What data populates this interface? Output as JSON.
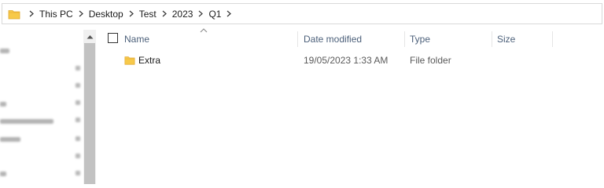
{
  "address_bar": {
    "breadcrumbs": [
      {
        "label": "This PC"
      },
      {
        "label": "Desktop"
      },
      {
        "label": "Test"
      },
      {
        "label": "2023"
      },
      {
        "label": "Q1"
      }
    ]
  },
  "columns": {
    "name": "Name",
    "date_modified": "Date modified",
    "type": "Type",
    "size": "Size"
  },
  "files": [
    {
      "name": "Extra",
      "date_modified": "19/05/2023 1:33 AM",
      "type": "File folder",
      "size": ""
    }
  ],
  "colors": {
    "folder": "#f7c94a",
    "header_text": "#4c607a",
    "scroll_thumb": "#c2c2c2"
  }
}
